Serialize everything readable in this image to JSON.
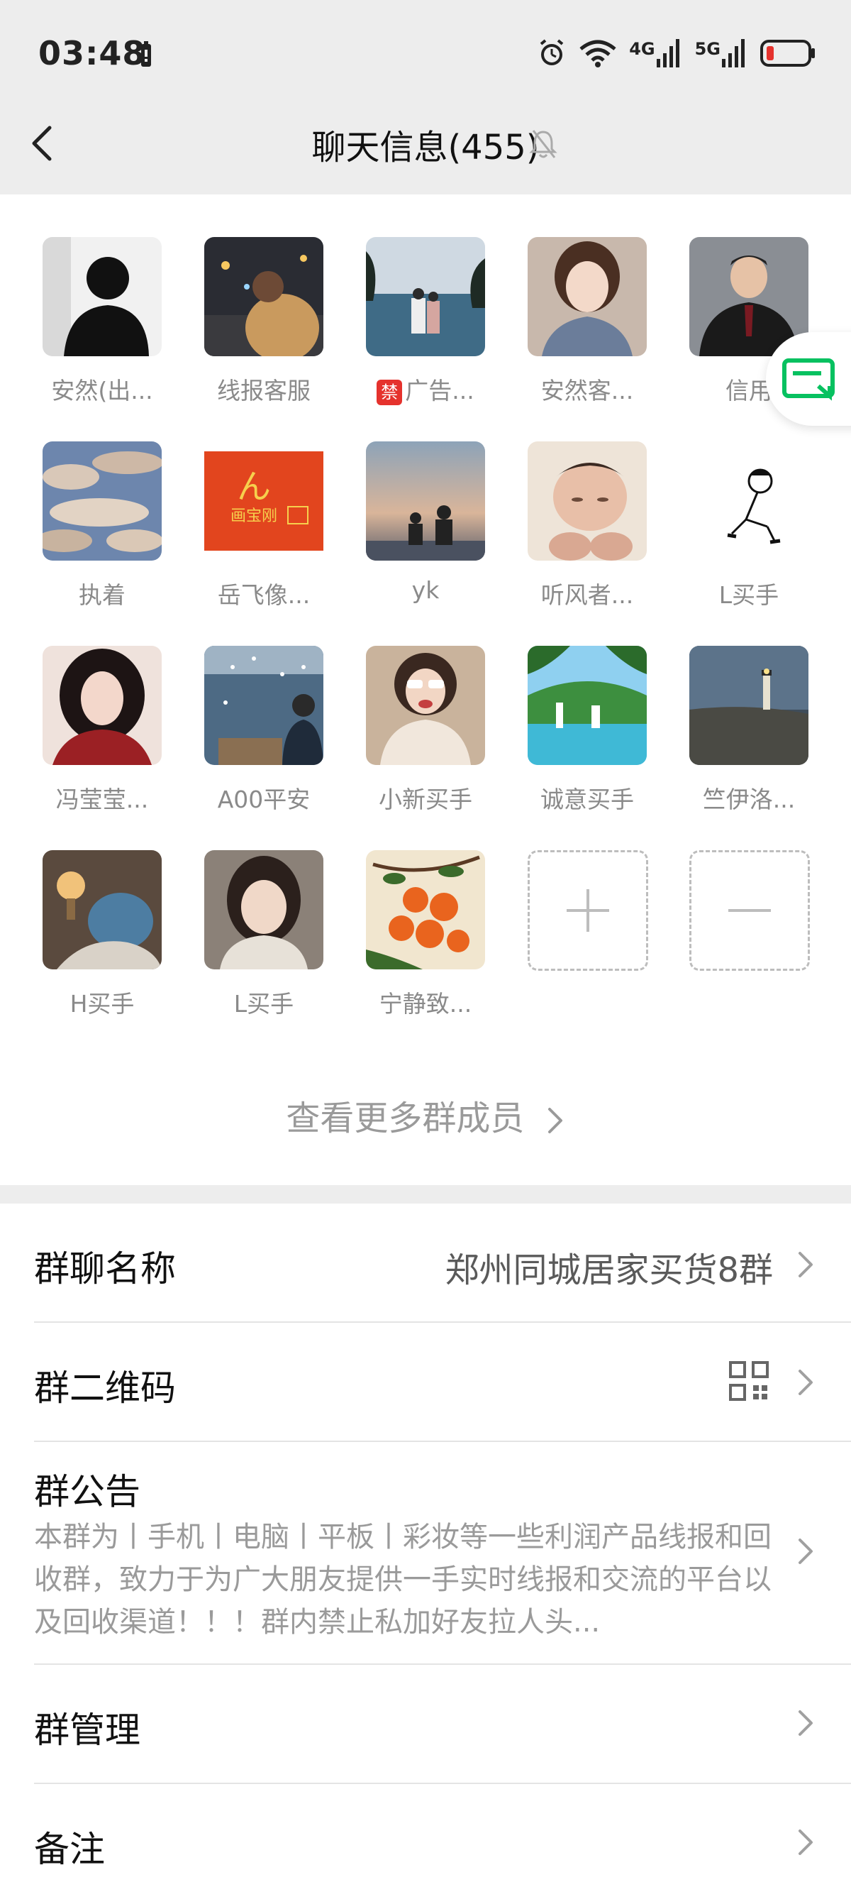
{
  "status_bar": {
    "time": "03:48",
    "network_1": "4G",
    "network_2": "5G"
  },
  "navbar": {
    "title": "聊天信息(455)",
    "icons": [
      "back-arrow-icon",
      "bell-mute-icon"
    ]
  },
  "members": [
    {
      "name": "安然(出...",
      "avatar": "silhouette-man"
    },
    {
      "name": "线报客服",
      "avatar": "street-night"
    },
    {
      "name": "广告...",
      "avatar": "beach-couple",
      "badge": "禁"
    },
    {
      "name": "安然客...",
      "avatar": "anime-girl"
    },
    {
      "name": "信用",
      "avatar": "man-suit"
    },
    {
      "name": "执着",
      "avatar": "cloudy-sky"
    },
    {
      "name": "岳飞像...",
      "avatar": "red-logo-画宝刚"
    },
    {
      "name": "yk",
      "avatar": "sunset-couple"
    },
    {
      "name": "听风者...",
      "avatar": "baby"
    },
    {
      "name": "L买手",
      "avatar": "sketch-boy"
    },
    {
      "name": "冯莹莹...",
      "avatar": "girl-red"
    },
    {
      "name": "A00平安",
      "avatar": "sea-birds"
    },
    {
      "name": "小新买手",
      "avatar": "girl-glasses"
    },
    {
      "name": "诚意买手",
      "avatar": "waterfall"
    },
    {
      "name": "竺伊洛...",
      "avatar": "lighthouse"
    },
    {
      "name": "H买手",
      "avatar": "plush-bed"
    },
    {
      "name": "L买手",
      "avatar": "girl-portrait"
    },
    {
      "name": "宁静致...",
      "avatar": "persimmons"
    }
  ],
  "add_member_icon": "plus-icon",
  "remove_member_icon": "minus-icon",
  "logo_text": "画宝刚",
  "more_members_label": "查看更多群成员",
  "float_button_icon": "screen-message-icon",
  "settings": {
    "group_name": {
      "label": "群聊名称",
      "value": "郑州同城居家买货8群"
    },
    "qr_code": {
      "label": "群二维码",
      "icon": "qr-code-icon"
    },
    "notice": {
      "label": "群公告",
      "text": "本群为丨手机丨电脑丨平板丨彩妆等一些利润产品线报和回收群，致力于为广大朋友提供一手实时线报和交流的平台以及回收渠道！！！群内禁止私加好友拉人头..."
    },
    "manage": {
      "label": "群管理"
    },
    "remark": {
      "label": "备注"
    }
  },
  "colors": {
    "header_bg": "#ededed",
    "accent_green": "#07c160",
    "badge_red": "#e5322d"
  }
}
